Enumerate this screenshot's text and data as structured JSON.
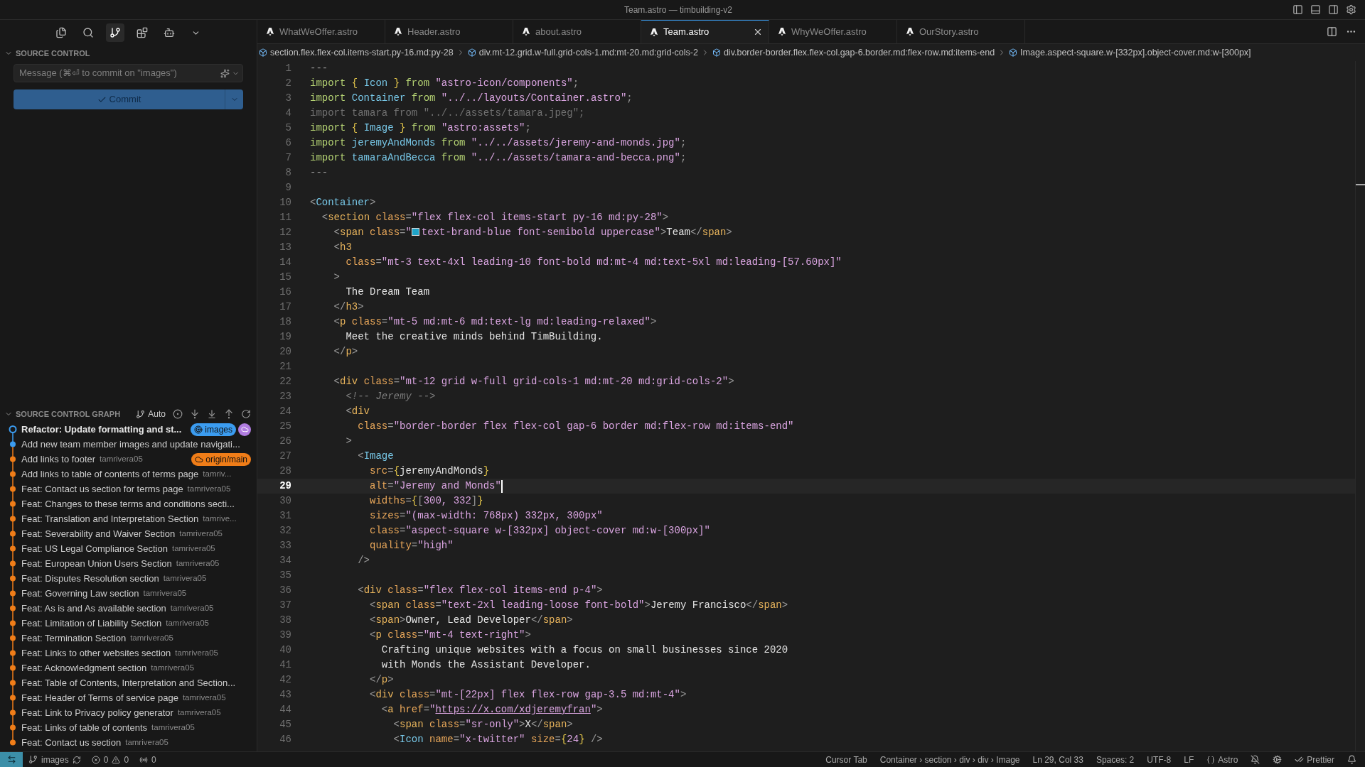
{
  "window": {
    "title": "Team.astro — timbuilding-v2"
  },
  "activity_bar": [
    {
      "kind": "explorer",
      "selected": false
    },
    {
      "kind": "search",
      "selected": false
    },
    {
      "kind": "source-control",
      "selected": true
    },
    {
      "kind": "extensions",
      "selected": false
    },
    {
      "kind": "assistant",
      "selected": false
    },
    {
      "kind": "more",
      "selected": false
    }
  ],
  "source_control": {
    "title": "SOURCE CONTROL",
    "message": {
      "placeholder": "Message (⌘⏎ to commit on \"images\")"
    },
    "commit_button": "Commit"
  },
  "graph": {
    "title": "SOURCE CONTROL GRAPH",
    "mode": "Auto",
    "commits": [
      {
        "message": "Refactor: Update formatting and st...",
        "current": true,
        "color": "#3b9cf0",
        "badges": [
          {
            "kind": "local",
            "label": "images",
            "color": "#3b9cf0"
          },
          {
            "kind": "remote-icon",
            "color": "#b07ce0"
          }
        ]
      },
      {
        "message": "Add new team member images and update navigati...",
        "current": false,
        "color": "#3b9cf0"
      },
      {
        "message": "Add links to footer",
        "author": "tamrivera05",
        "current": false,
        "color": "#f07d18",
        "badges": [
          {
            "kind": "remote",
            "label": "origin/main",
            "color": "#f07d18"
          }
        ]
      },
      {
        "message": "Add links to table of contents of terms page",
        "author": "tamriv...",
        "current": false,
        "color": "#f07d18"
      },
      {
        "message": "Feat: Contact us section for terms page",
        "author": "tamrivera05",
        "current": false,
        "color": "#f07d18"
      },
      {
        "message": "Feat: Changes to these terms and conditions secti...",
        "current": false,
        "color": "#f07d18"
      },
      {
        "message": "Feat: Translation and Interpretation Section",
        "author": "tamrive...",
        "current": false,
        "color": "#f07d18"
      },
      {
        "message": "Feat: Severability and Waiver Section",
        "author": "tamrivera05",
        "current": false,
        "color": "#f07d18"
      },
      {
        "message": "Feat: US Legal Compliance Section",
        "author": "tamrivera05",
        "current": false,
        "color": "#f07d18"
      },
      {
        "message": "Feat: European Union Users Section",
        "author": "tamrivera05",
        "current": false,
        "color": "#f07d18"
      },
      {
        "message": "Feat: Disputes Resolution section",
        "author": "tamrivera05",
        "current": false,
        "color": "#f07d18"
      },
      {
        "message": "Feat: Governing Law section",
        "author": "tamrivera05",
        "current": false,
        "color": "#f07d18"
      },
      {
        "message": "Feat: As is and As available section",
        "author": "tamrivera05",
        "current": false,
        "color": "#f07d18"
      },
      {
        "message": "Feat: Limitation of Liability Section",
        "author": "tamrivera05",
        "current": false,
        "color": "#f07d18"
      },
      {
        "message": "Feat: Termination Section",
        "author": "tamrivera05",
        "current": false,
        "color": "#f07d18"
      },
      {
        "message": "Feat: Links to other websites section",
        "author": "tamrivera05",
        "current": false,
        "color": "#f07d18"
      },
      {
        "message": "Feat: Acknowledgment section",
        "author": "tamrivera05",
        "current": false,
        "color": "#f07d18"
      },
      {
        "message": "Feat: Table of Contents, Interpretation and Section...",
        "current": false,
        "color": "#f07d18"
      },
      {
        "message": "Feat: Header of Terms of service page",
        "author": "tamrivera05",
        "current": false,
        "color": "#f07d18"
      },
      {
        "message": "Feat: Link to Privacy policy generator",
        "author": "tamrivera05",
        "current": false,
        "color": "#f07d18"
      },
      {
        "message": "Feat: Links of table of contents",
        "author": "tamrivera05",
        "current": false,
        "color": "#f07d18"
      },
      {
        "message": "Feat: Contact us section",
        "author": "tamrivera05",
        "current": false,
        "color": "#f07d18"
      }
    ]
  },
  "tabs": [
    {
      "label": "WhatWeOffer.astro",
      "selected": false
    },
    {
      "label": "Header.astro",
      "selected": false
    },
    {
      "label": "about.astro",
      "selected": false
    },
    {
      "label": "Team.astro",
      "selected": true
    },
    {
      "label": "WhyWeOffer.astro",
      "selected": false
    },
    {
      "label": "OurStory.astro",
      "selected": false
    }
  ],
  "breadcrumbs": [
    "section.flex.flex-col.items-start.py-16.md:py-28",
    "div.mt-12.grid.w-full.grid-cols-1.md:mt-20.md:grid-cols-2",
    "div.border-border.flex.flex-col.gap-6.border.md:flex-row.md:items-end",
    "Image.aspect-square.w-[332px].object-cover.md:w-[300px]"
  ],
  "editor": {
    "lines": [
      {
        "number": "1",
        "current": false,
        "tokens": [
          {
            "kind": "pn",
            "text": "---"
          }
        ]
      },
      {
        "number": "2",
        "current": false,
        "tokens": [
          {
            "kind": "kw",
            "text": "import "
          },
          {
            "kind": "br",
            "text": "{ "
          },
          {
            "kind": "id",
            "text": "Icon "
          },
          {
            "kind": "br",
            "text": "} "
          },
          {
            "kind": "kw",
            "text": "from "
          },
          {
            "kind": "str",
            "text": "\"astro-icon/components\""
          },
          {
            "kind": "pn",
            "text": ";"
          }
        ]
      },
      {
        "number": "3",
        "current": false,
        "tokens": [
          {
            "kind": "kw",
            "text": "import "
          },
          {
            "kind": "id",
            "text": "Container "
          },
          {
            "kind": "kw",
            "text": "from "
          },
          {
            "kind": "str",
            "text": "\"../../layouts/Container.astro\""
          },
          {
            "kind": "pn",
            "text": ";"
          }
        ]
      },
      {
        "number": "4",
        "current": false,
        "tokens": [
          {
            "kind": "dim",
            "text": "import tamara from \"../../assets/tamara.jpeg\";"
          }
        ]
      },
      {
        "number": "5",
        "current": false,
        "tokens": [
          {
            "kind": "kw",
            "text": "import "
          },
          {
            "kind": "br",
            "text": "{ "
          },
          {
            "kind": "id",
            "text": "Image "
          },
          {
            "kind": "br",
            "text": "} "
          },
          {
            "kind": "kw",
            "text": "from "
          },
          {
            "kind": "str",
            "text": "\"astro:assets\""
          },
          {
            "kind": "pn",
            "text": ";"
          }
        ]
      },
      {
        "number": "6",
        "current": false,
        "tokens": [
          {
            "kind": "kw",
            "text": "import "
          },
          {
            "kind": "id",
            "text": "jeremyAndMonds "
          },
          {
            "kind": "kw",
            "text": "from "
          },
          {
            "kind": "str",
            "text": "\"../../assets/jeremy-and-monds.jpg\""
          },
          {
            "kind": "pn",
            "text": ";"
          }
        ]
      },
      {
        "number": "7",
        "current": false,
        "tokens": [
          {
            "kind": "kw",
            "text": "import "
          },
          {
            "kind": "id",
            "text": "tamaraAndBecca "
          },
          {
            "kind": "kw",
            "text": "from "
          },
          {
            "kind": "str",
            "text": "\"../../assets/tamara-and-becca.png\""
          },
          {
            "kind": "pn",
            "text": ";"
          }
        ]
      },
      {
        "number": "8",
        "current": false,
        "tokens": [
          {
            "kind": "pn",
            "text": "---"
          }
        ]
      },
      {
        "number": "9",
        "current": false
      },
      {
        "number": "10",
        "current": false,
        "tokens": [
          {
            "kind": "pn",
            "text": "<"
          },
          {
            "kind": "id",
            "text": "Container"
          },
          {
            "kind": "pn",
            "text": ">"
          }
        ]
      },
      {
        "number": "11",
        "current": false,
        "tokens": [
          {
            "kind": "pn",
            "text": "  <"
          },
          {
            "kind": "tag",
            "text": "section "
          },
          {
            "kind": "at",
            "text": "class"
          },
          {
            "kind": "pn",
            "text": "="
          },
          {
            "kind": "str",
            "text": "\"flex flex-col items-start py-16 md:py-28\""
          },
          {
            "kind": "pn",
            "text": ">"
          }
        ]
      },
      {
        "number": "12",
        "current": false,
        "tokens": [
          {
            "kind": "pn",
            "text": "    <"
          },
          {
            "kind": "tag",
            "text": "span "
          },
          {
            "kind": "at",
            "text": "class"
          },
          {
            "kind": "pn",
            "text": "="
          },
          {
            "kind": "str",
            "text": "\""
          },
          {
            "kind": "sw",
            "color": "#1fa3c7"
          },
          {
            "kind": "str",
            "text": "text-brand-blue font-semibold uppercase\""
          },
          {
            "kind": "pn",
            "text": ">"
          },
          {
            "kind": "tx",
            "text": "Team"
          },
          {
            "kind": "pn",
            "text": "</"
          },
          {
            "kind": "tag",
            "text": "span"
          },
          {
            "kind": "pn",
            "text": ">"
          }
        ]
      },
      {
        "number": "13",
        "current": false,
        "tokens": [
          {
            "kind": "pn",
            "text": "    <"
          },
          {
            "kind": "tag",
            "text": "h3"
          }
        ]
      },
      {
        "number": "14",
        "current": false,
        "tokens": [
          {
            "kind": "at",
            "text": "      class"
          },
          {
            "kind": "pn",
            "text": "="
          },
          {
            "kind": "str",
            "text": "\"mt-3 text-4xl leading-10 font-bold md:mt-4 md:text-5xl md:leading-[57.60px]\""
          }
        ]
      },
      {
        "number": "15",
        "current": false,
        "tokens": [
          {
            "kind": "pn",
            "text": "    >"
          }
        ]
      },
      {
        "number": "16",
        "current": false,
        "tokens": [
          {
            "kind": "tx",
            "text": "      The Dream Team"
          }
        ]
      },
      {
        "number": "17",
        "current": false,
        "tokens": [
          {
            "kind": "pn",
            "text": "    </"
          },
          {
            "kind": "tag",
            "text": "h3"
          },
          {
            "kind": "pn",
            "text": ">"
          }
        ]
      },
      {
        "number": "18",
        "current": false,
        "tokens": [
          {
            "kind": "pn",
            "text": "    <"
          },
          {
            "kind": "tag",
            "text": "p "
          },
          {
            "kind": "at",
            "text": "class"
          },
          {
            "kind": "pn",
            "text": "="
          },
          {
            "kind": "str",
            "text": "\"mt-5 md:mt-6 md:text-lg md:leading-relaxed\""
          },
          {
            "kind": "pn",
            "text": ">"
          }
        ]
      },
      {
        "number": "19",
        "current": false,
        "tokens": [
          {
            "kind": "tx",
            "text": "      Meet the creative minds behind TimBuilding."
          }
        ]
      },
      {
        "number": "20",
        "current": false,
        "tokens": [
          {
            "kind": "pn",
            "text": "    </"
          },
          {
            "kind": "tag",
            "text": "p"
          },
          {
            "kind": "pn",
            "text": ">"
          }
        ]
      },
      {
        "number": "21",
        "current": false
      },
      {
        "number": "22",
        "current": false,
        "tokens": [
          {
            "kind": "pn",
            "text": "    <"
          },
          {
            "kind": "tag",
            "text": "div "
          },
          {
            "kind": "at",
            "text": "class"
          },
          {
            "kind": "pn",
            "text": "="
          },
          {
            "kind": "str",
            "text": "\"mt-12 grid w-full grid-cols-1 md:mt-20 md:grid-cols-2\""
          },
          {
            "kind": "pn",
            "text": ">"
          }
        ]
      },
      {
        "number": "23",
        "current": false,
        "tokens": [
          {
            "kind": "cm",
            "text": "      <!-- Jeremy -->"
          }
        ]
      },
      {
        "number": "24",
        "current": false,
        "tokens": [
          {
            "kind": "pn",
            "text": "      <"
          },
          {
            "kind": "tag",
            "text": "div"
          }
        ]
      },
      {
        "number": "25",
        "current": false,
        "tokens": [
          {
            "kind": "at",
            "text": "        class"
          },
          {
            "kind": "pn",
            "text": "="
          },
          {
            "kind": "str",
            "text": "\"border-border flex flex-col gap-6 border md:flex-row md:items-end\""
          }
        ]
      },
      {
        "number": "26",
        "current": false,
        "tokens": [
          {
            "kind": "pn",
            "text": "      >"
          }
        ]
      },
      {
        "number": "27",
        "current": false,
        "tokens": [
          {
            "kind": "pn",
            "text": "        <"
          },
          {
            "kind": "id",
            "text": "Image"
          }
        ]
      },
      {
        "number": "28",
        "current": false,
        "tokens": [
          {
            "kind": "at",
            "text": "          src"
          },
          {
            "kind": "pn",
            "text": "="
          },
          {
            "kind": "br",
            "text": "{"
          },
          {
            "kind": "tx",
            "text": "jeremyAndMonds"
          },
          {
            "kind": "br",
            "text": "}"
          }
        ]
      },
      {
        "number": "29",
        "current": true,
        "tokens": [
          {
            "kind": "at",
            "text": "          alt"
          },
          {
            "kind": "pn",
            "text": "="
          },
          {
            "kind": "str",
            "text": "\"Jeremy and Monds\""
          }
        ]
      },
      {
        "number": "30",
        "current": false,
        "tokens": [
          {
            "kind": "at",
            "text": "          widths"
          },
          {
            "kind": "pn",
            "text": "="
          },
          {
            "kind": "br",
            "text": "{"
          },
          {
            "kind": "pn",
            "text": "["
          },
          {
            "kind": "str",
            "text": "300, 332"
          },
          {
            "kind": "pn",
            "text": "]"
          },
          {
            "kind": "br",
            "text": "}"
          }
        ]
      },
      {
        "number": "31",
        "current": false,
        "tokens": [
          {
            "kind": "at",
            "text": "          sizes"
          },
          {
            "kind": "pn",
            "text": "="
          },
          {
            "kind": "str",
            "text": "\"(max-width: 768px) 332px, 300px\""
          }
        ]
      },
      {
        "number": "32",
        "current": false,
        "tokens": [
          {
            "kind": "at",
            "text": "          class"
          },
          {
            "kind": "pn",
            "text": "="
          },
          {
            "kind": "str",
            "text": "\"aspect-square w-[332px] object-cover md:w-[300px]\""
          }
        ]
      },
      {
        "number": "33",
        "current": false,
        "tokens": [
          {
            "kind": "at",
            "text": "          quality"
          },
          {
            "kind": "pn",
            "text": "="
          },
          {
            "kind": "str",
            "text": "\"high\""
          }
        ]
      },
      {
        "number": "34",
        "current": false,
        "tokens": [
          {
            "kind": "pn",
            "text": "        />"
          }
        ]
      },
      {
        "number": "35",
        "current": false
      },
      {
        "number": "36",
        "current": false,
        "tokens": [
          {
            "kind": "pn",
            "text": "        <"
          },
          {
            "kind": "tag",
            "text": "div "
          },
          {
            "kind": "at",
            "text": "class"
          },
          {
            "kind": "pn",
            "text": "="
          },
          {
            "kind": "str",
            "text": "\"flex flex-col items-end p-4\""
          },
          {
            "kind": "pn",
            "text": ">"
          }
        ]
      },
      {
        "number": "37",
        "current": false,
        "tokens": [
          {
            "kind": "pn",
            "text": "          <"
          },
          {
            "kind": "tag",
            "text": "span "
          },
          {
            "kind": "at",
            "text": "class"
          },
          {
            "kind": "pn",
            "text": "="
          },
          {
            "kind": "str",
            "text": "\"text-2xl leading-loose font-bold\""
          },
          {
            "kind": "pn",
            "text": ">"
          },
          {
            "kind": "tx",
            "text": "Jeremy Francisco"
          },
          {
            "kind": "pn",
            "text": "</"
          },
          {
            "kind": "tag",
            "text": "span"
          },
          {
            "kind": "pn",
            "text": ">"
          }
        ]
      },
      {
        "number": "38",
        "current": false,
        "tokens": [
          {
            "kind": "pn",
            "text": "          <"
          },
          {
            "kind": "tag",
            "text": "span"
          },
          {
            "kind": "pn",
            "text": ">"
          },
          {
            "kind": "tx",
            "text": "Owner, Lead Developer"
          },
          {
            "kind": "pn",
            "text": "</"
          },
          {
            "kind": "tag",
            "text": "span"
          },
          {
            "kind": "pn",
            "text": ">"
          }
        ]
      },
      {
        "number": "39",
        "current": false,
        "tokens": [
          {
            "kind": "pn",
            "text": "          <"
          },
          {
            "kind": "tag",
            "text": "p "
          },
          {
            "kind": "at",
            "text": "class"
          },
          {
            "kind": "pn",
            "text": "="
          },
          {
            "kind": "str",
            "text": "\"mt-4 text-right\""
          },
          {
            "kind": "pn",
            "text": ">"
          }
        ]
      },
      {
        "number": "40",
        "current": false,
        "tokens": [
          {
            "kind": "tx",
            "text": "            Crafting unique websites with a focus on small businesses since 2020"
          }
        ]
      },
      {
        "number": "41",
        "current": false,
        "tokens": [
          {
            "kind": "tx",
            "text": "            with Monds the Assistant Developer."
          }
        ]
      },
      {
        "number": "42",
        "current": false,
        "tokens": [
          {
            "kind": "pn",
            "text": "          </"
          },
          {
            "kind": "tag",
            "text": "p"
          },
          {
            "kind": "pn",
            "text": ">"
          }
        ]
      },
      {
        "number": "43",
        "current": false,
        "tokens": [
          {
            "kind": "pn",
            "text": "          <"
          },
          {
            "kind": "tag",
            "text": "div "
          },
          {
            "kind": "at",
            "text": "class"
          },
          {
            "kind": "pn",
            "text": "="
          },
          {
            "kind": "str",
            "text": "\"mt-[22px] flex flex-row gap-3.5 md:mt-4\""
          },
          {
            "kind": "pn",
            "text": ">"
          }
        ]
      },
      {
        "number": "44",
        "current": false,
        "tokens": [
          {
            "kind": "pn",
            "text": "            <"
          },
          {
            "kind": "tag",
            "text": "a "
          },
          {
            "kind": "at",
            "text": "href"
          },
          {
            "kind": "pn",
            "text": "="
          },
          {
            "kind": "str",
            "text": "\""
          },
          {
            "kind": "link",
            "text": "https://x.com/xdjeremyfran"
          },
          {
            "kind": "str",
            "text": "\""
          },
          {
            "kind": "pn",
            "text": ">"
          }
        ]
      },
      {
        "number": "45",
        "current": false,
        "tokens": [
          {
            "kind": "pn",
            "text": "              <"
          },
          {
            "kind": "tag",
            "text": "span "
          },
          {
            "kind": "at",
            "text": "class"
          },
          {
            "kind": "pn",
            "text": "="
          },
          {
            "kind": "str",
            "text": "\"sr-only\""
          },
          {
            "kind": "pn",
            "text": ">"
          },
          {
            "kind": "tx",
            "text": "X"
          },
          {
            "kind": "pn",
            "text": "</"
          },
          {
            "kind": "tag",
            "text": "span"
          },
          {
            "kind": "pn",
            "text": ">"
          }
        ]
      },
      {
        "number": "46",
        "current": false,
        "tokens": [
          {
            "kind": "pn",
            "text": "              <"
          },
          {
            "kind": "id",
            "text": "Icon "
          },
          {
            "kind": "at",
            "text": "name"
          },
          {
            "kind": "pn",
            "text": "="
          },
          {
            "kind": "str",
            "text": "\"x-twitter\" "
          },
          {
            "kind": "at",
            "text": "size"
          },
          {
            "kind": "pn",
            "text": "="
          },
          {
            "kind": "br",
            "text": "{"
          },
          {
            "kind": "str",
            "text": "24"
          },
          {
            "kind": "br",
            "text": "}"
          },
          {
            "kind": "pn",
            "text": " />"
          }
        ]
      }
    ]
  },
  "status_bar": {
    "branch": "images",
    "errors": "0",
    "warnings": "0",
    "ports": "0",
    "right": [
      {
        "kind": "text",
        "label": "Cursor Tab"
      },
      {
        "kind": "text",
        "label": "Container › section › div › div › Image"
      },
      {
        "kind": "text",
        "label": "Ln 29, Col 33"
      },
      {
        "kind": "text",
        "label": "Spaces: 2"
      },
      {
        "kind": "text",
        "label": "UTF-8"
      },
      {
        "kind": "text",
        "label": "LF"
      },
      {
        "kind": "language",
        "label": "Astro"
      },
      {
        "kind": "icon-copilot-off"
      },
      {
        "kind": "icon-gear"
      },
      {
        "kind": "formatter",
        "label": "Prettier"
      },
      {
        "kind": "icon-bell"
      }
    ]
  }
}
